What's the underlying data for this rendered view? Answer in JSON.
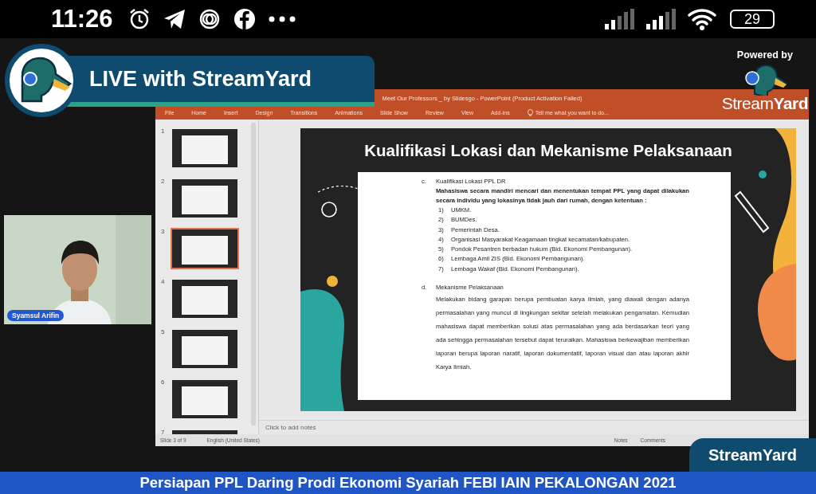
{
  "status_bar": {
    "time": "11:26",
    "battery": "29"
  },
  "stream": {
    "banner_title": "LIVE with StreamYard",
    "powered_by": "Powered by",
    "brand": "Stream**Yard**",
    "participant": {
      "name": "Syamsul Arifin"
    },
    "corner_brand": "StreamYard",
    "ticker": "Persiapan PPL Daring Prodi Ekonomi Syariah FEBI IAIN PEKALONGAN 2021"
  },
  "powerpoint": {
    "title": "Meet Our Professors _ by Slidesgo - PowerPoint (Product Activation Failed)",
    "tabs": [
      "File",
      "Home",
      "Insert",
      "Design",
      "Transitions",
      "Animations",
      "Slide Show",
      "Review",
      "View",
      "Add-ins"
    ],
    "tell_me": "Tell me what you want to do...",
    "thumbnails": [
      {
        "number": "1",
        "selected": false
      },
      {
        "number": "2",
        "selected": false
      },
      {
        "number": "3",
        "selected": true
      },
      {
        "number": "4",
        "selected": false
      },
      {
        "number": "5",
        "selected": false
      },
      {
        "number": "6",
        "selected": false
      },
      {
        "number": "7",
        "selected": false
      }
    ],
    "slide": {
      "title": "Kualifikasi Lokasi dan Mekanisme Pelaksanaan",
      "sections": [
        {
          "marker": "c.",
          "heading": "Kualifikasi Lokasi PPL DR",
          "paragraph": "Mahasiswa secara mandiri mencari dan menentukan tempat PPL yang dapat dilakukan secara individu yang lokasinya tidak jauh dari rumah, dengan ketentuan :",
          "paragraph_bold": true,
          "items": [
            {
              "number": "1)",
              "text": "UMKM."
            },
            {
              "number": "2)",
              "text": "BUMDes."
            },
            {
              "number": "3)",
              "text": "Pemerintah Desa."
            },
            {
              "number": "4)",
              "text": "Organisasi Masyarakat Keagamaan tingkat kecamatan/kabupaten."
            },
            {
              "number": "5)",
              "text": "Pondok Pesantren berbadan hukum (Bid. Ekonomi Pembangunan)."
            },
            {
              "number": "6)",
              "text": "Lembaga Amil ZIS (Bid. Ekonomi Pembangunan)."
            },
            {
              "number": "7)",
              "text": "Lembaga Wakaf (Bid. Ekonomi Pembangunan)."
            }
          ]
        },
        {
          "marker": "d.",
          "heading": "Mekanisme Pelaksanaan",
          "paragraph": "Melakukan bidang garapan berupa pembuatan karya ilmiah, yang diawali dengan adanya permasalahan yang muncul di lingkungan sekitar setelah melakukan pengamatan. Kemudian mahasiswa dapat memberikan solusi atas permasalahan yang ada berdasarkan teori yang ada sehingga permasalahan tersebut dapat teruraikan. Mahasiswa berkewajiban memberikan laporan berupa laporan naratif, laporan dokumentatif, laporan visual dan atau laporan akhir Karya Ilmiah.",
          "paragraph_bold": false
        }
      ]
    },
    "notes_placeholder": "Click to add notes",
    "status": {
      "slide": "Slide 3 of 9",
      "language": "English (United States)",
      "notes": "Notes",
      "comments": "Comments"
    }
  }
}
